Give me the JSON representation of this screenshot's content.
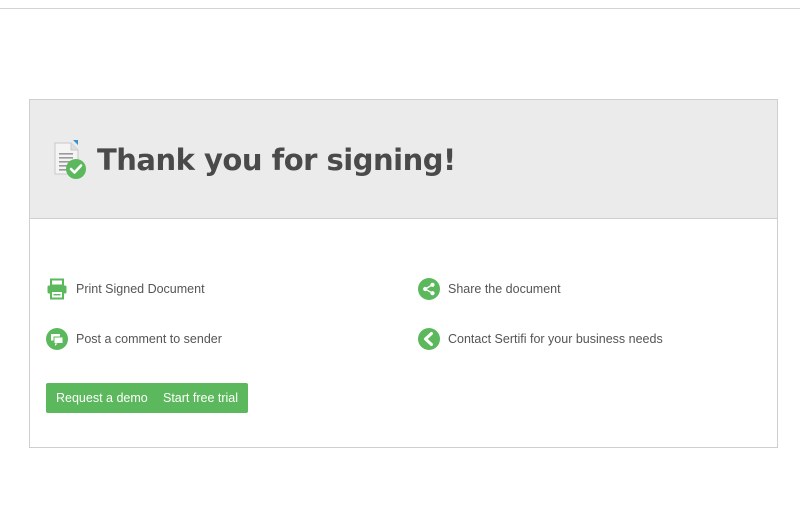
{
  "header": {
    "title": "Thank you for signing!"
  },
  "actions": {
    "print": {
      "label": "Print Signed Document",
      "icon": "printer-icon"
    },
    "share": {
      "label": "Share the document",
      "icon": "share-icon"
    },
    "comment": {
      "label": "Post a comment to sender",
      "icon": "comment-icon"
    },
    "contact": {
      "label": "Contact Sertifi for your business needs",
      "icon": "chevron-left-icon"
    }
  },
  "buttons": {
    "demo": "Request a demo",
    "trial": "Start free trial"
  },
  "colors": {
    "accent": "#5cb85c",
    "header_bg": "#ebebeb",
    "title": "#4a4a4a",
    "text": "#555555"
  }
}
